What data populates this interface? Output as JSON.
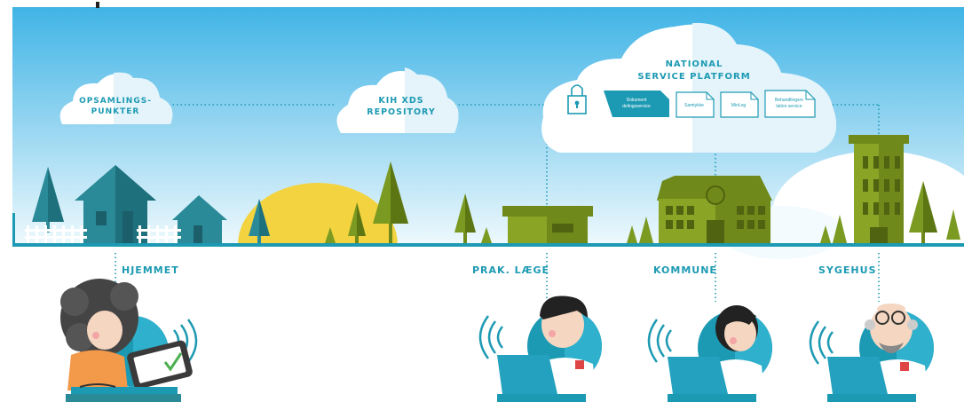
{
  "clouds": {
    "opsamling": {
      "line1": "OPSAMLINGS-",
      "line2": "PUNKTER"
    },
    "kih": {
      "line1": "KIH XDS",
      "line2": "REPOSITORY"
    },
    "nsp": {
      "line1": "NATIONAL",
      "line2": "SERVICE PLATFORM",
      "services": [
        {
          "l1": "Dokument",
          "l2": "delingsservice"
        },
        {
          "l1": "Samtykke",
          "l2": ""
        },
        {
          "l1": "MinLog",
          "l2": ""
        },
        {
          "l1": "Behandlingsre",
          "l2": "lation service"
        }
      ]
    }
  },
  "locations": {
    "hjemmet": "HJEMMET",
    "praklaege": "PRAK. LÆGE",
    "kommune": "KOMMUNE",
    "sygehus": "SYGEHUS"
  },
  "colors": {
    "sky_top": "#3fb4e6",
    "sky_bottom": "#e6f6fc",
    "teal": "#1d9ab3",
    "house_teal": "#2a8a98",
    "olive": "#6f8a1a",
    "sun": "#f3d33f"
  }
}
